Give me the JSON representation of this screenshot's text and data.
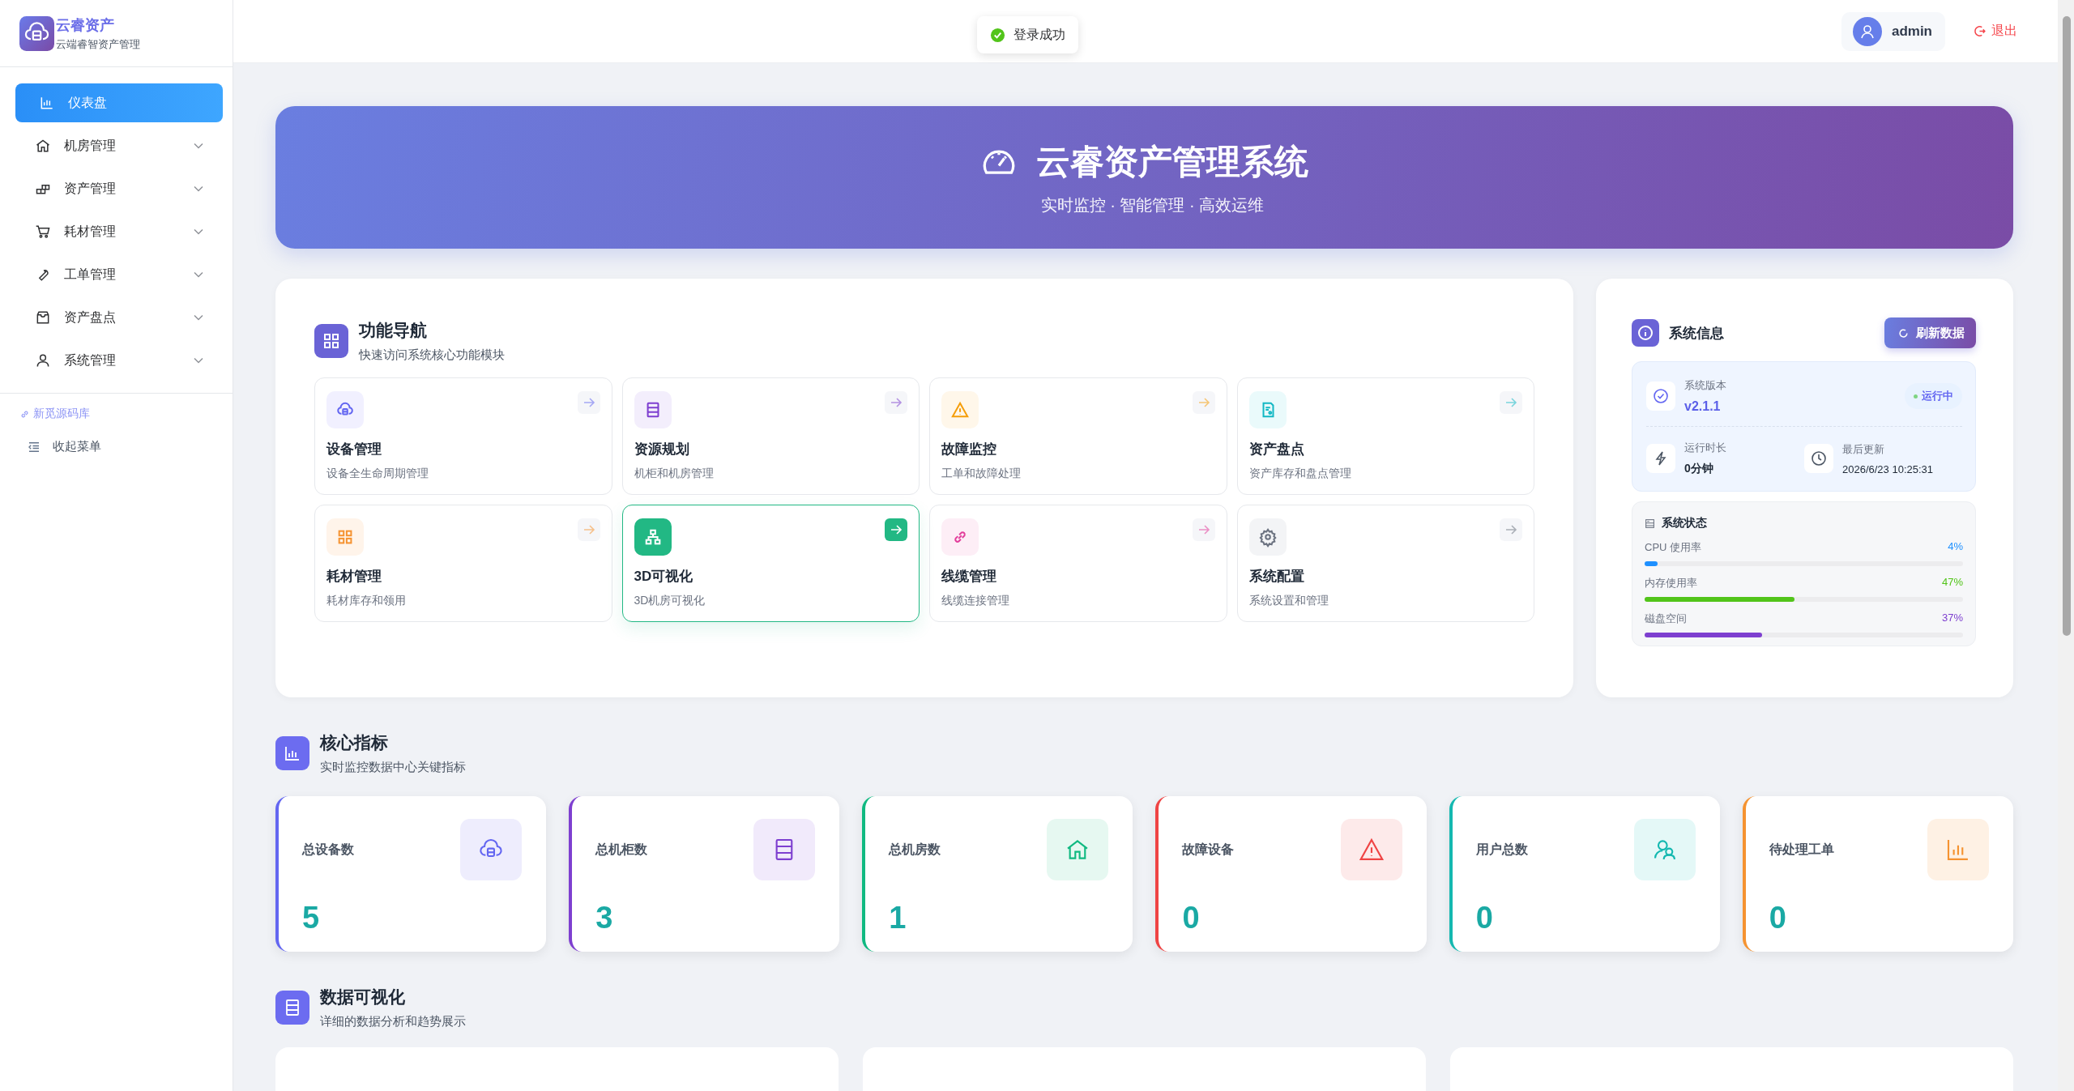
{
  "sidebar": {
    "logo_title": "云睿资产",
    "logo_subtitle": "云端睿智资产管理",
    "items": [
      {
        "label": "仪表盘",
        "selected": true,
        "expandable": false
      },
      {
        "label": "机房管理",
        "selected": false,
        "expandable": true
      },
      {
        "label": "资产管理",
        "selected": false,
        "expandable": true
      },
      {
        "label": "耗材管理",
        "selected": false,
        "expandable": true
      },
      {
        "label": "工单管理",
        "selected": false,
        "expandable": true
      },
      {
        "label": "资产盘点",
        "selected": false,
        "expandable": true
      },
      {
        "label": "系统管理",
        "selected": false,
        "expandable": true
      }
    ],
    "link": "新觅源码库",
    "collapse": "收起菜单"
  },
  "header": {
    "toast": "登录成功",
    "user": "admin",
    "logout": "退出"
  },
  "hero": {
    "title": "云睿资产管理系统",
    "subtitle": "实时监控 · 智能管理 · 高效运维"
  },
  "function_nav": {
    "title": "功能导航",
    "subtitle": "快速访问系统核心功能模块",
    "items": [
      {
        "title": "设备管理",
        "desc": "设备全生命周期管理",
        "selected": false
      },
      {
        "title": "资源规划",
        "desc": "机柜和机房管理",
        "selected": false
      },
      {
        "title": "故障监控",
        "desc": "工单和故障处理",
        "selected": false
      },
      {
        "title": "资产盘点",
        "desc": "资产库存和盘点管理",
        "selected": false
      },
      {
        "title": "耗材管理",
        "desc": "耗材库存和领用",
        "selected": false
      },
      {
        "title": "3D可视化",
        "desc": "3D机房可视化",
        "selected": true
      },
      {
        "title": "线缆管理",
        "desc": "线缆连接管理",
        "selected": false
      },
      {
        "title": "系统配置",
        "desc": "系统设置和管理",
        "selected": false
      }
    ]
  },
  "system_info": {
    "title": "系统信息",
    "refresh": "刷新数据",
    "version_label": "系统版本",
    "version": "v2.1.1",
    "status": "运行中",
    "uptime_label": "运行时长",
    "uptime": "0分钟",
    "updated_label": "最后更新",
    "updated": "2026/6/23 10:25:31",
    "status_title": "系统状态",
    "meters": [
      {
        "name": "CPU 使用率",
        "reading": "4%",
        "level": 0.04,
        "color": "#1e90ff"
      },
      {
        "name": "内存使用率",
        "reading": "47%",
        "level": 0.47,
        "color": "#52c41a"
      },
      {
        "name": "磁盘空间",
        "reading": "37%",
        "level": 0.37,
        "color": "#7e3fd0"
      }
    ]
  },
  "core_metrics": {
    "title": "核心指标",
    "subtitle": "实时监控数据中心关键指标",
    "cards": [
      {
        "label": "总设备数",
        "value": "5",
        "color": "#6366f1"
      },
      {
        "label": "总机柜数",
        "value": "3",
        "color": "#7e3fd0"
      },
      {
        "label": "总机房数",
        "value": "1",
        "color": "#10b981"
      },
      {
        "label": "故障设备",
        "value": "0",
        "color": "#ef4444"
      },
      {
        "label": "用户总数",
        "value": "0",
        "color": "#14b8b0"
      },
      {
        "label": "待处理工单",
        "value": "0",
        "color": "#f59331"
      }
    ]
  },
  "data_visualization": {
    "title": "数据可视化",
    "subtitle": "详细的数据分析和趋势展示"
  }
}
